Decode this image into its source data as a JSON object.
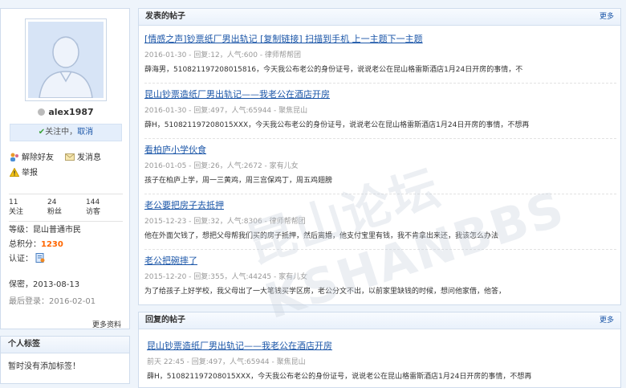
{
  "profile": {
    "username": "alex1987",
    "follow_status": "关注中，",
    "cancel": "取消",
    "actions": {
      "unfriend": "解除好友",
      "message": "发消息",
      "report": "举报"
    },
    "stats": [
      {
        "value": "11",
        "label": "关注"
      },
      {
        "value": "24",
        "label": "粉丝"
      },
      {
        "value": "144",
        "label": "访客"
      }
    ],
    "level_label": "等级：",
    "level_value": "昆山普通市民",
    "points_label": "总积分：",
    "points_value": "1230",
    "verify_label": "认证：",
    "birthday": "保密，2013-08-13",
    "last_login": "最后登录：2016-02-01",
    "more_info": "更多资料"
  },
  "tags": {
    "title": "个人标签",
    "empty": "暂时没有添加标签！"
  },
  "posts": {
    "title": "发表的帖子",
    "more": "更多",
    "items": [
      {
        "title": "[情感之声]钞票纸厂男出轨记 [复制链接] 扫描到手机 上一主题下一主题",
        "meta": "2016-01-30 - 回复:12，人气:600 - 律师帮帮团",
        "snippet": "薛海男，510821197208015816，今天我公布老公的身份证号，说说老公在昆山格雷斯酒店1月24日开房的事情，不"
      },
      {
        "title": "昆山钞票造纸厂男出轨记——我老公在酒店开房",
        "meta": "2016-01-30 - 回复:497，人气:65944 - 聚焦昆山",
        "snippet": "薛H，510821197208015XXX，今天我公布老公的身份证号，说说老公在昆山格雷斯酒店1月24日开房的事情，不想再"
      },
      {
        "title": "看柏庐小学伙食",
        "meta": "2016-01-05 - 回复:26，人气:2672 - 家有儿女",
        "snippet": "孩子在柏庐上学，周一三黄鸡，周三宫保鸡丁，周五鸡翅膀"
      },
      {
        "title": "老公要把房子去抵押",
        "meta": "2015-12-23 - 回复:32，人气:8306 - 律师帮帮团",
        "snippet": "他在外面欠钱了，想把父母帮我们买的房子抵押，然后离婚，他支付宝里有钱，我不肯拿出来还，我该怎么办法"
      },
      {
        "title": "老公把碗摔了",
        "meta": "2015-12-20 - 回复:355，人气:44245 - 家有儿女",
        "snippet": "为了给孩子上好学校，我父母出了一大笔钱买学区房，老公分文不出，以前家里缺钱的时候，想问他家借，他答，"
      }
    ]
  },
  "replies": {
    "title": "回复的帖子",
    "more": "更多",
    "items": [
      {
        "title": "昆山钞票造纸厂男出轨记——我老公在酒店开房",
        "meta": "前天 22:45 - 回复:497，人气:65944 - 聚焦昆山",
        "snippet": "薛H，510821197208015XXX，今天我公布老公的身份证号，说说老公在昆山格雷斯酒店1月24日开房的事情，不想再"
      }
    ]
  },
  "watermark": "昆山论坛 KSHANBBS",
  "colors": {
    "link": "#1b56a8",
    "points": "#ff6600",
    "check": "#3aa33a",
    "background": "#eef4fb"
  }
}
